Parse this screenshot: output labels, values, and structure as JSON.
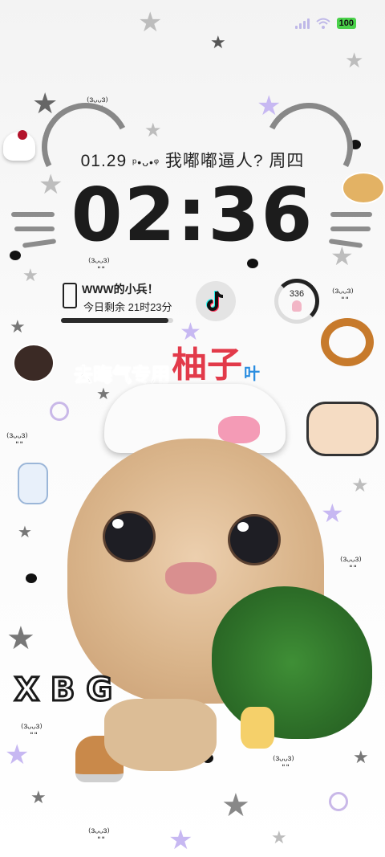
{
  "status_bar": {
    "battery": "100"
  },
  "date_line": {
    "date": "01.29",
    "deco": "ᵖ•ᴗ•ᵠ",
    "text": "我嘟嘟逼人? 周四"
  },
  "clock": {
    "time": "02:36"
  },
  "screen_time_widget": {
    "title": "WWW的小兵！",
    "remaining": "今日剩余 21时23分",
    "progress": 0.96
  },
  "tiktok_widget": {
    "icon": "tiktok-icon"
  },
  "counter_widget": {
    "value": "336"
  },
  "banner": {
    "part1": "去晦气专用",
    "part2": "柚子",
    "part3": "叶"
  },
  "sticker_text": {
    "letters": [
      "X",
      "B",
      "G"
    ]
  },
  "kaomoji": "⁽³ᵕ͈ᵕ͈³⁾",
  "colors": {
    "ring": "#222222",
    "banner_red": "#e23a4a",
    "banner_blue": "#2a8de0"
  }
}
